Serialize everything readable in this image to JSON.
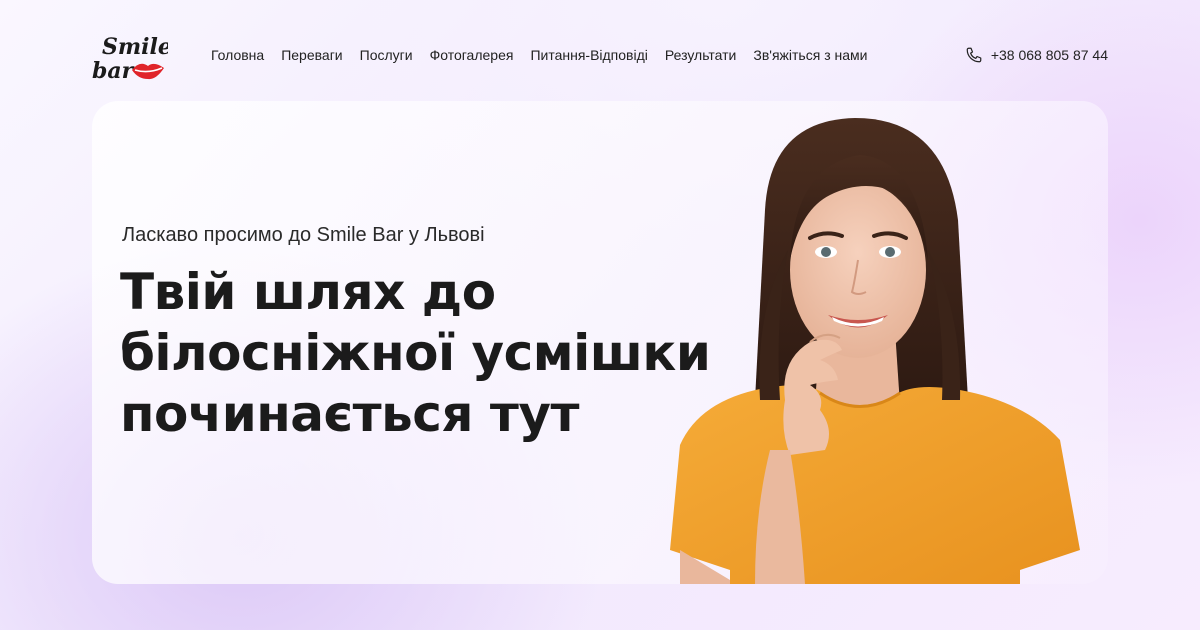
{
  "brand": {
    "logo_text_1": "Smile",
    "logo_text_2": "bar"
  },
  "nav": {
    "items": [
      {
        "label": "Головна"
      },
      {
        "label": "Переваги"
      },
      {
        "label": "Послуги"
      },
      {
        "label": "Фотогалерея"
      },
      {
        "label": "Питання-Відповіді"
      },
      {
        "label": "Результати"
      },
      {
        "label": "Зв'яжіться з нами"
      }
    ]
  },
  "contact": {
    "phone_icon": "phone-icon",
    "phone": "+38 068 805 87 44"
  },
  "hero": {
    "subtitle": "Ласкаво просимо до Smile Bar у Львові",
    "headline_lines": [
      "Твій шлях до",
      "білосніжної усмішки",
      "починається тут"
    ]
  },
  "colors": {
    "lips": "#e0242a",
    "text": "#1d1d1f",
    "shirt": "#f0a12e",
    "background_accent": "#e6d4fa"
  }
}
